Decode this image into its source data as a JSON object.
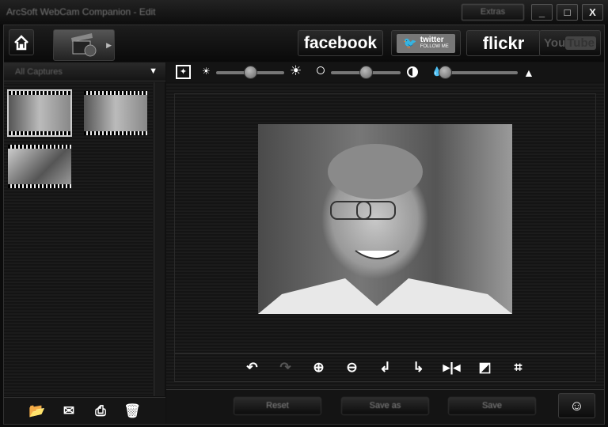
{
  "window": {
    "title": "ArcSoft WebCam Companion - Edit",
    "extras_label": "Extras",
    "minimize": "_",
    "maximize": "□",
    "close": "X"
  },
  "toolbar": {
    "home_icon": "home-icon",
    "edit_icon": "clapperboard-icon",
    "share": {
      "facebook": "facebook",
      "twitter": "twitter",
      "twitter_sub": "FOLLOW ME",
      "flickr": "flickr",
      "youtube_you": "You",
      "youtube_tube": "Tube"
    }
  },
  "sidebar": {
    "filter": "All Captures",
    "thumbnails": [
      {
        "kind": "portrait"
      },
      {
        "kind": "portrait"
      },
      {
        "kind": "toy"
      }
    ]
  },
  "adjustments": {
    "brightness": 0.5,
    "contrast": 0.5,
    "saturation": 0.0
  },
  "actions": {
    "reset": "Reset",
    "save_as": "Save as",
    "save": "Save"
  },
  "edit_tools": [
    "rotate-undo",
    "redo",
    "zoom-in",
    "zoom-out",
    "rotate-left",
    "rotate-right",
    "flip",
    "resize",
    "crop"
  ]
}
